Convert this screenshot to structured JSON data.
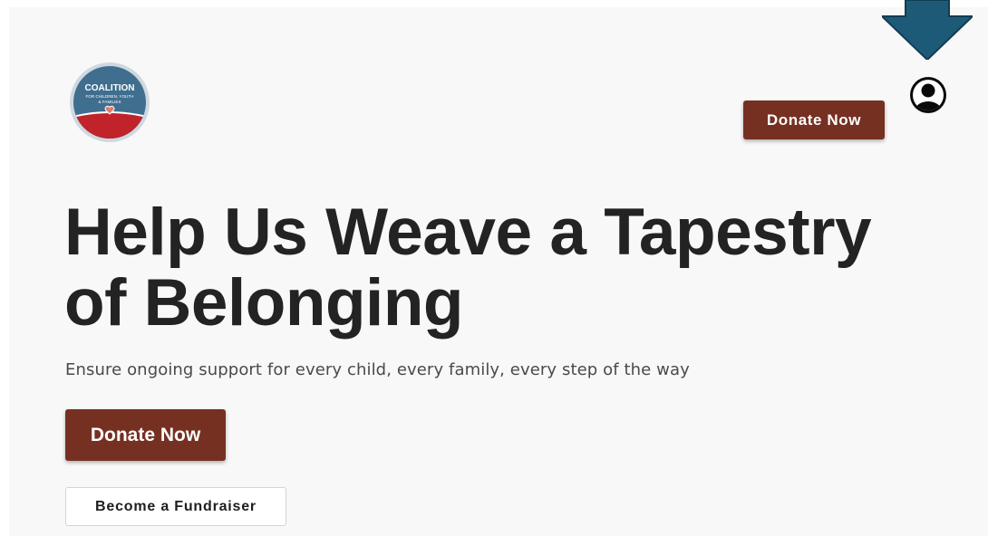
{
  "header": {
    "logo": {
      "title": "COALITION",
      "subtitle_line1": "FOR CHILDREN, YOUTH",
      "subtitle_line2": "& FAMILIES",
      "colors": {
        "blue": "#3f6e8f",
        "red": "#c0232a",
        "ring": "#cfd8e0"
      }
    },
    "donate_label": "Donate Now",
    "account_icon": "account-circle-icon"
  },
  "hero": {
    "title_line1": "Help Us Weave a Tapestry",
    "title_line2": "of Belonging",
    "subtitle": "Ensure ongoing support for every child, every family, every step of the way",
    "donate_label": "Donate Now",
    "fundraiser_label": "Become a Fundraiser"
  },
  "annotation": {
    "icon": "down-arrow-icon",
    "color": "#1d5a78"
  },
  "colors": {
    "button_brand": "#763022",
    "heading": "#232323",
    "background": "#f8f8f8"
  }
}
